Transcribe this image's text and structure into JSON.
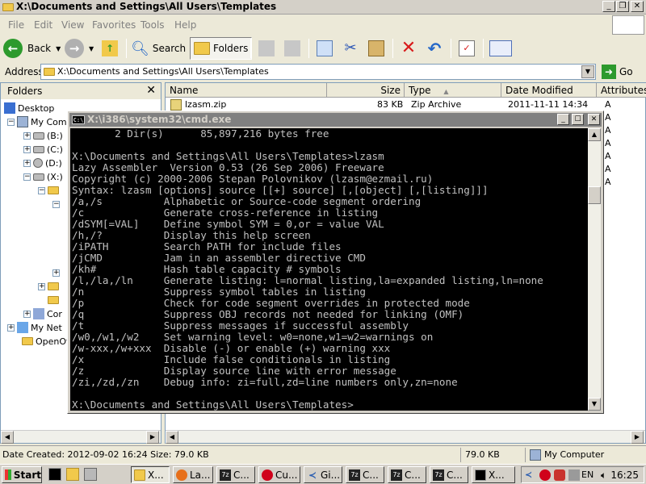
{
  "explorer": {
    "title": "X:\\Documents and Settings\\All Users\\Templates",
    "menu": [
      "File",
      "Edit",
      "View",
      "Favorites",
      "Tools",
      "Help"
    ],
    "toolbar": {
      "back": "Back",
      "search": "Search",
      "folders": "Folders"
    },
    "address_label": "Address",
    "address_value": "X:\\Documents and Settings\\All Users\\Templates",
    "go_label": "Go",
    "folders_header": "Folders",
    "tree": {
      "desktop": "Desktop",
      "my_computer": "My Com",
      "drive_b": "(B:)",
      "drive_c": "(C:)",
      "drive_d": "(D:)",
      "drive_x": "(X:)",
      "control": "Cor",
      "my_network": "My Net",
      "openoffice": "OpenOf"
    },
    "columns": [
      "Name",
      "Size",
      "Type",
      "Date Modified",
      "Attributes"
    ],
    "files": [
      {
        "name": "lzasm.zip",
        "size": "83 KB",
        "type": "Zip Archive",
        "date": "2011-11-11 14:34",
        "attr": "A"
      }
    ],
    "attr_column_extra": [
      "A",
      "A",
      "A",
      "A",
      "A",
      "A"
    ],
    "status": {
      "left": "Date Created: 2012-09-02 16:24 Size: 79.0 KB",
      "size": "79.0 KB",
      "zone": "My Computer"
    }
  },
  "console": {
    "title": "X:\\i386\\system32\\cmd.exe",
    "icon_text": "C:\\",
    "lines": [
      "       2 Dir(s)      85,897,216 bytes free",
      "",
      "X:\\Documents and Settings\\All Users\\Templates>lzasm",
      "Lazy Assembler  Version 0.53 (26 Sep 2006) Freeware",
      "Copyright (c) 2000-2006 Stepan Polovnikov (lzasm@ezmail.ru)",
      "Syntax: lzasm [options] source [[+] source] [,[object] [,[listing]]]",
      "/a,/s          Alphabetic or Source-code segment ordering",
      "/c             Generate cross-reference in listing",
      "/dSYM[=VAL]    Define symbol SYM = 0,or = value VAL",
      "/h,/?          Display this help screen",
      "/iPATH         Search PATH for include files",
      "/jCMD          Jam in an assembler directive CMD",
      "/kh#           Hash table capacity # symbols",
      "/l,/la,/ln     Generate listing: l=normal listing,la=expanded listing,ln=none",
      "/n             Suppress symbol tables in listing",
      "/p             Check for code segment overrides in protected mode",
      "/q             Suppress OBJ records not needed for linking (OMF)",
      "/t             Suppress messages if successful assembly",
      "/w0,/w1,/w2    Set warning level: w0=none,w1=w2=warnings on",
      "/w-xxx,/w+xxx  Disable (-) or enable (+) warning xxx",
      "/x             Include false conditionals in listing",
      "/z             Display source line with error message",
      "/zi,/zd,/zn    Debug info: zi=full,zd=line numbers only,zn=none",
      "",
      "X:\\Documents and Settings\\All Users\\Templates>"
    ]
  },
  "taskbar": {
    "start": "Start",
    "tasks": [
      "X...",
      "La...",
      "C...",
      "Cu...",
      "Gi...",
      "C...",
      "C...",
      "C...",
      "X..."
    ],
    "language": "EN",
    "clock": "16:25"
  }
}
